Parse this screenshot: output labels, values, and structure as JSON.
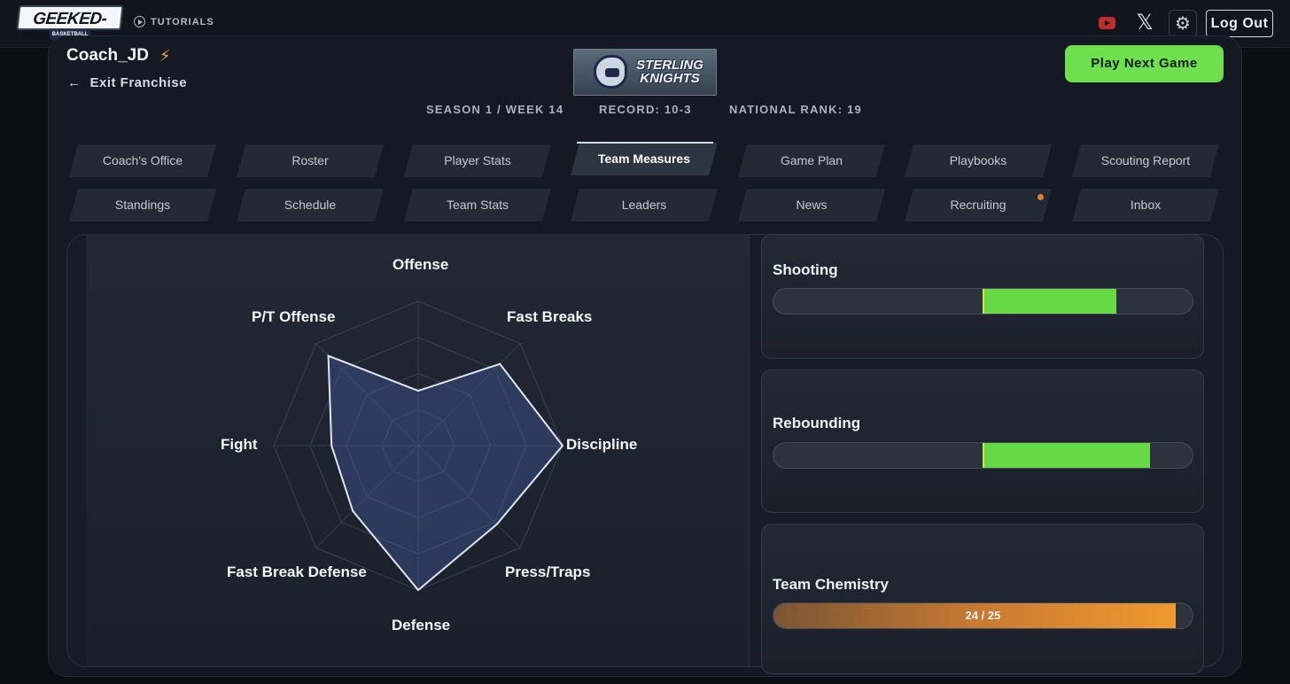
{
  "header": {
    "logo_text": "GEEKED-OUT",
    "logo_sub": "BASKETBALL",
    "tutorials": "TUTORIALS",
    "logout": "Log Out",
    "icons": [
      "youtube-icon",
      "x-icon",
      "gear-icon"
    ]
  },
  "franchise": {
    "coach_name": "Coach_JD",
    "exit_label": "Exit Franchise",
    "team_name_line1": "STERLING",
    "team_name_line2": "KNIGHTS",
    "play_next": "Play Next Game",
    "season": "SEASON 1 / WEEK 14",
    "record": "RECORD: 10-3",
    "rank": "NATIONAL RANK: 19"
  },
  "tabs_row1": [
    "Coach's Office",
    "Roster",
    "Player Stats",
    "Team Measures",
    "Game Plan",
    "Playbooks",
    "Scouting Report"
  ],
  "tabs_row2": [
    "Standings",
    "Schedule",
    "Team Stats",
    "Leaders",
    "News",
    "Recruiting",
    "Inbox"
  ],
  "active_tab": "Team Measures",
  "radar": {
    "axes": [
      "Offense",
      "Fast Breaks",
      "Discipline",
      "Press/Traps",
      "Defense",
      "Fast Break Defense",
      "Fight",
      "P/T Offense"
    ],
    "values": [
      0.38,
      0.8,
      1.0,
      0.77,
      1.0,
      0.64,
      0.6,
      0.88
    ],
    "rings": 4
  },
  "measures": {
    "shooting_label": "Shooting",
    "shooting_value": 0.32,
    "rebounding_label": "Rebounding",
    "rebounding_value": 0.4,
    "chemistry_label": "Team Chemistry",
    "chemistry_text": "24 / 25",
    "chemistry_value": 0.96
  },
  "colors": {
    "accent_green": "#6ee04d",
    "chemistry_orange": "#f0982f",
    "notification": "#e0802e"
  }
}
